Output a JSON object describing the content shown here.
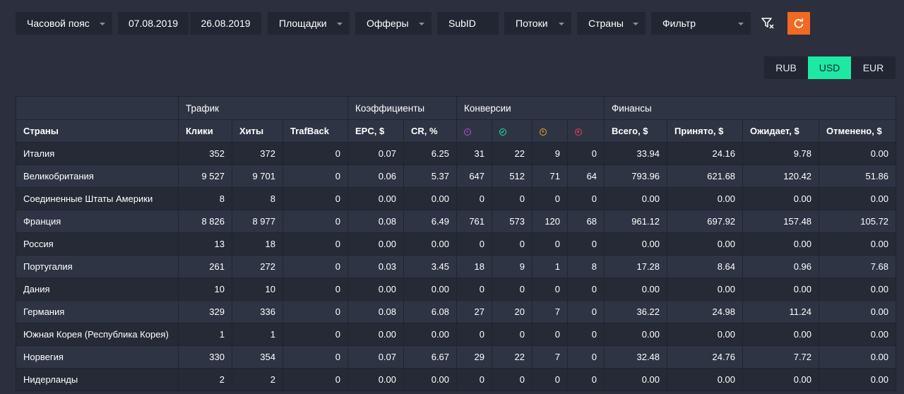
{
  "toolbar": {
    "timezone": "Часовой пояс",
    "date_from": "07.08.2019",
    "date_to": "26.08.2019",
    "platforms": "Площадки",
    "offers": "Офферы",
    "subid": "SubID",
    "streams": "Потоки",
    "countries": "Страны",
    "filter": "Фильтр",
    "icons": [
      "filter-clear-icon",
      "refresh-icon"
    ],
    "accent": "#f26a21"
  },
  "currency": {
    "options": [
      "RUB",
      "USD",
      "EUR"
    ],
    "selected": "USD",
    "active_color": "#1de9a3"
  },
  "table": {
    "groups": {
      "traffic": "Трафик",
      "coefficients": "Коэффициенты",
      "conversions": "Конверсии",
      "finance": "Финансы"
    },
    "headers": {
      "country": "Страны",
      "clicks": "Клики",
      "hits": "Хиты",
      "trafback": "TrafBack",
      "epc": "EPC, $",
      "cr": "CR, %",
      "conv_icons": [
        "total-conversions-icon",
        "approved-icon",
        "pending-icon",
        "rejected-icon"
      ],
      "conv_colors": [
        "#b84fd6",
        "#1de9a3",
        "#f5a623",
        "#e0405a"
      ],
      "total": "Всего, $",
      "accepted": "Принято, $",
      "waiting": "Ожидает, $",
      "cancelled": "Отменено, $"
    },
    "rows": [
      [
        "Италия",
        "352",
        "372",
        "0",
        "0.07",
        "6.25",
        "31",
        "22",
        "9",
        "0",
        "33.94",
        "24.16",
        "9.78",
        "0.00"
      ],
      [
        "Великобритания",
        "9 527",
        "9 701",
        "0",
        "0.06",
        "5.37",
        "647",
        "512",
        "71",
        "64",
        "793.96",
        "621.68",
        "120.42",
        "51.86"
      ],
      [
        "Соединенные Штаты Америки",
        "8",
        "8",
        "0",
        "0.00",
        "0.00",
        "0",
        "0",
        "0",
        "0",
        "0.00",
        "0.00",
        "0.00",
        "0.00"
      ],
      [
        "Франция",
        "8 826",
        "8 977",
        "0",
        "0.08",
        "6.49",
        "761",
        "573",
        "120",
        "68",
        "961.12",
        "697.92",
        "157.48",
        "105.72"
      ],
      [
        "Россия",
        "13",
        "18",
        "0",
        "0.00",
        "0.00",
        "0",
        "0",
        "0",
        "0",
        "0.00",
        "0.00",
        "0.00",
        "0.00"
      ],
      [
        "Португалия",
        "261",
        "272",
        "0",
        "0.03",
        "3.45",
        "18",
        "9",
        "1",
        "8",
        "17.28",
        "8.64",
        "0.96",
        "7.68"
      ],
      [
        "Дания",
        "10",
        "10",
        "0",
        "0.00",
        "0.00",
        "0",
        "0",
        "0",
        "0",
        "0.00",
        "0.00",
        "0.00",
        "0.00"
      ],
      [
        "Германия",
        "329",
        "336",
        "0",
        "0.08",
        "6.08",
        "27",
        "20",
        "7",
        "0",
        "36.22",
        "24.98",
        "11.24",
        "0.00"
      ],
      [
        "Южная Корея (Республика Корея)",
        "1",
        "1",
        "0",
        "0.00",
        "0.00",
        "0",
        "0",
        "0",
        "0",
        "0.00",
        "0.00",
        "0.00",
        "0.00"
      ],
      [
        "Норвегия",
        "330",
        "354",
        "0",
        "0.07",
        "6.67",
        "29",
        "22",
        "7",
        "0",
        "32.48",
        "24.76",
        "7.72",
        "0.00"
      ],
      [
        "Нидерланды",
        "2",
        "2",
        "0",
        "0.00",
        "0.00",
        "0",
        "0",
        "0",
        "0",
        "0.00",
        "0.00",
        "0.00",
        "0.00"
      ]
    ]
  }
}
